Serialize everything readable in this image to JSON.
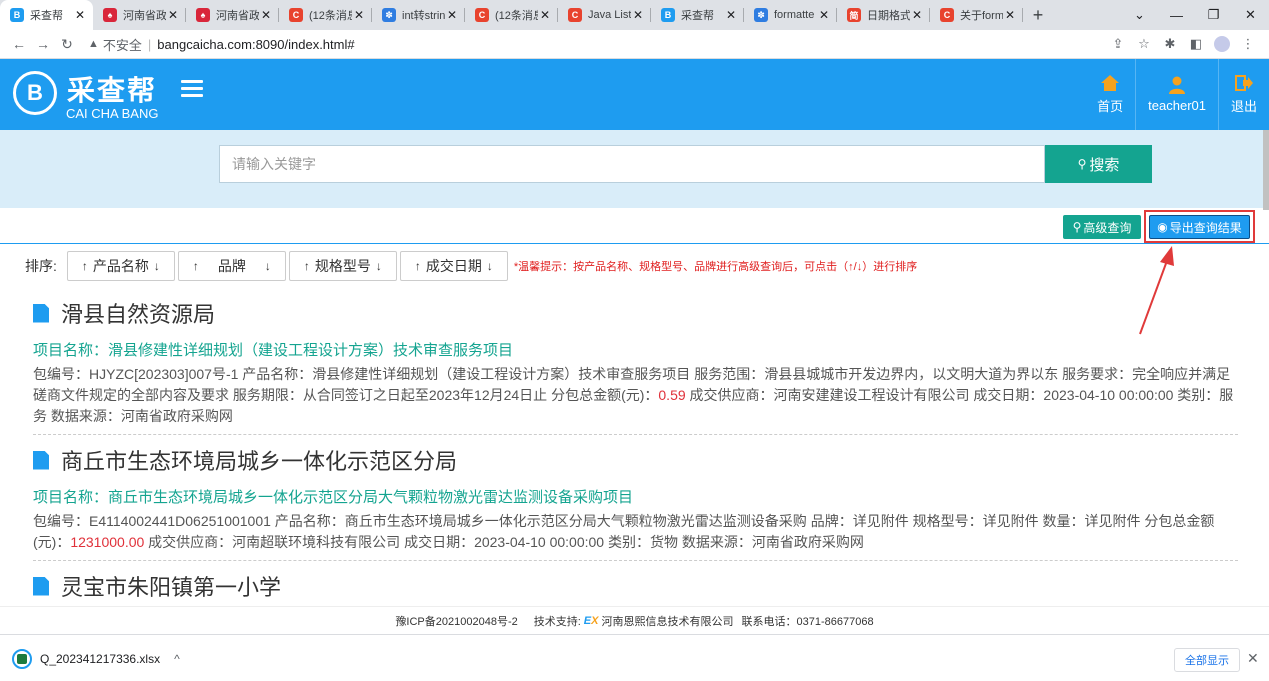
{
  "browser": {
    "tabs": [
      {
        "title": "采查帮",
        "favicon_color": "#1e9cf0",
        "favicon_glyph": "B",
        "active": true
      },
      {
        "title": "河南省政",
        "favicon_color": "#d9263a",
        "favicon_glyph": "♠",
        "active": false
      },
      {
        "title": "河南省政",
        "favicon_color": "#d9263a",
        "favicon_glyph": "♠",
        "active": false
      },
      {
        "title": "(12条消息",
        "favicon_color": "#e8432e",
        "favicon_glyph": "C",
        "active": false
      },
      {
        "title": "int转strin",
        "favicon_color": "#2f7de1",
        "favicon_glyph": "✽",
        "active": false
      },
      {
        "title": "(12条消息",
        "favicon_color": "#e8432e",
        "favicon_glyph": "C",
        "active": false
      },
      {
        "title": "Java List",
        "favicon_color": "#e8432e",
        "favicon_glyph": "C",
        "active": false
      },
      {
        "title": "采查帮",
        "favicon_color": "#1e9cf0",
        "favicon_glyph": "B",
        "active": false
      },
      {
        "title": "formatte",
        "favicon_color": "#2f7de1",
        "favicon_glyph": "✽",
        "active": false
      },
      {
        "title": "日期格式",
        "favicon_color": "#e8432e",
        "favicon_glyph": "简",
        "active": false
      },
      {
        "title": "关于form",
        "favicon_color": "#e8432e",
        "favicon_glyph": "C",
        "active": false
      }
    ],
    "new_tab": "+",
    "address": {
      "security_label": "不安全",
      "url": "bangcaicha.com:8090/index.html#"
    }
  },
  "header": {
    "logo_cn": "采查帮",
    "logo_en": "CAI CHA BANG",
    "nav": [
      {
        "label": "首页",
        "icon": "home-icon"
      },
      {
        "label": "teacher01",
        "icon": "user-icon"
      },
      {
        "label": "退出",
        "icon": "logout-icon"
      }
    ]
  },
  "search": {
    "placeholder": "请输入关键字",
    "button_label": "搜索"
  },
  "actions": {
    "advanced_label": "高级查询",
    "export_label": "导出查询结果"
  },
  "sort": {
    "label": "排序:",
    "buttons": [
      "产品名称",
      "品牌",
      "规格型号",
      "成交日期"
    ],
    "hint": "*温馨提示：按产品名称、规格型号、品牌进行高级查询后，可点击（↑/↓）进行排序"
  },
  "results": [
    {
      "title": "滑县自然资源局",
      "project": "项目名称：滑县修建性详细规划（建设工程设计方案）技术审查服务项目",
      "desc_before": "包编号：HJYZC[202303]007号-1  产品名称：滑县修建性详细规划（建设工程设计方案）技术审查服务项目  服务范围：滑县县城城市开发边界内，以文明大道为界以东  服务要求：完全响应并满足磋商文件规定的全部内容及要求  服务期限：从合同签订之日起至2023年12月24日止  分包总金额(元)：",
      "amount": "0.59",
      "desc_after": "  成交供应商：河南安建建设工程设计有限公司  成交日期：2023-04-10 00:00:00  类别：服务  数据来源：河南省政府采购网"
    },
    {
      "title": "商丘市生态环境局城乡一体化示范区分局",
      "project": "项目名称：商丘市生态环境局城乡一体化示范区分局大气颗粒物激光雷达监测设备采购项目",
      "desc_before": "包编号：E4114002441D06251001001  产品名称：商丘市生态环境局城乡一体化示范区分局大气颗粒物激光雷达监测设备采购  品牌：详见附件  规格型号：详见附件  数量：详见附件  分包总金额(元)：",
      "amount": "1231000.00",
      "desc_after": "  成交供应商：河南超联环境科技有限公司  成交日期：2023-04-10 00:00:00  类别：货物  数据来源：河南省政府采购网"
    },
    {
      "title": "灵宝市朱阳镇第一小学",
      "project": "",
      "desc_before": "",
      "amount": "",
      "desc_after": ""
    }
  ],
  "footer": {
    "icp": "豫ICP备2021002048号-2",
    "support_label": "技术支持:",
    "company": "河南恩熙信息技术有限公司",
    "phone": "联系电话：0371-86677068"
  },
  "download": {
    "filename": "Q_202341217336.xlsx",
    "show_all": "全部显示"
  },
  "colors": {
    "brand_blue": "#1e9cf0",
    "teal": "#14a490",
    "highlight_red": "#e03a3a"
  }
}
